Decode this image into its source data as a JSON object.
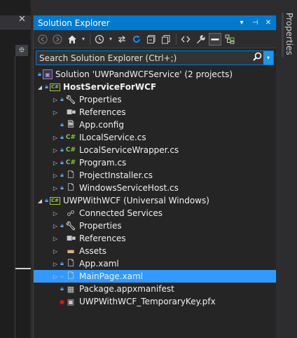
{
  "panel": {
    "title": "Solution Explorer",
    "dropdown_glyph": "▾",
    "pin_glyph": "⊣",
    "close_glyph": "✕"
  },
  "side_tab": {
    "label": "Properties"
  },
  "left_strip": {
    "close_glyph": "✕",
    "pin_glyph": "⯐"
  },
  "toolbar": {
    "icons": [
      "back-icon",
      "forward-icon",
      "home-icon",
      "dropdown-icon",
      "history-icon",
      "sync-icon",
      "refresh-icon",
      "collapse-all-icon",
      "copy-icon",
      "code-view-icon",
      "properties-wrench-icon",
      "preview-icon",
      "class-view-icon"
    ]
  },
  "search": {
    "placeholder": "Search Solution Explorer (Ctrl+;)"
  },
  "tree": {
    "solution": "Solution 'UWPandWCFService' (2 projects)",
    "project1": {
      "name": "HostServiceForWCF",
      "items": {
        "properties": "Properties",
        "references": "References",
        "app_config": "App.config",
        "ilocalservice": "ILocalService.cs",
        "localservicewrapper": "LocalServiceWrapper.cs",
        "program": "Program.cs",
        "projectinstaller": "ProjectInstaller.cs",
        "windowsservicehost": "WindowsServiceHost.cs"
      }
    },
    "project2": {
      "name": "UWPWithWCF (Universal Windows)",
      "items": {
        "connected_services": "Connected Services",
        "properties": "Properties",
        "references": "References",
        "assets": "Assets",
        "app_xaml": "App.xaml",
        "mainpage_xaml": "MainPage.xaml",
        "package_manifest": "Package.appxmanifest",
        "temporary_key": "UWPWithWCF_TemporaryKey.pfx"
      }
    },
    "selected_item": "MainPage.xaml"
  },
  "colors": {
    "accent": "#007acc",
    "selection": "#3399ff",
    "background": "#252526",
    "csharp": "#8ac24a",
    "project_border": "#9aca3c"
  }
}
